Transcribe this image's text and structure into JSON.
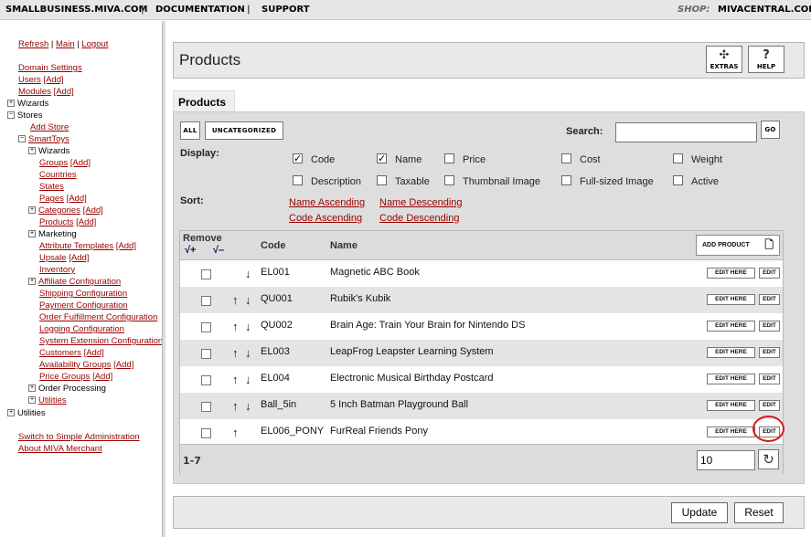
{
  "topbar": {
    "links": [
      "SMALLBUSINESS.MIVA.COM",
      "DOCUMENTATION",
      "SUPPORT"
    ],
    "separator": "|",
    "shop_label": "SHOP:",
    "shop_value": "MIVACENTRAL.COM"
  },
  "leftnav": {
    "refresh": "Refresh",
    "sep": "|",
    "main": "Main",
    "logout": "Logout",
    "domain_settings": "Domain Settings",
    "users": "Users",
    "add": "[Add]",
    "modules": "Modules",
    "wizards": "Wizards",
    "stores": "Stores",
    "add_store": "Add Store",
    "smarttoys": "SmartToys",
    "store_items": [
      {
        "label": "Wizards",
        "tree": true,
        "link": false,
        "add": false
      },
      {
        "label": "Groups",
        "tree": false,
        "link": true,
        "add": true
      },
      {
        "label": "Countries",
        "tree": false,
        "link": true,
        "add": false
      },
      {
        "label": "States",
        "tree": false,
        "link": true,
        "add": false
      },
      {
        "label": "Pages",
        "tree": false,
        "link": true,
        "add": true
      },
      {
        "label": "Categories",
        "tree": true,
        "link": true,
        "add": true
      },
      {
        "label": "Products",
        "tree": false,
        "link": true,
        "add": true
      },
      {
        "label": "Marketing",
        "tree": true,
        "link": false,
        "add": false
      },
      {
        "label": "Attribute Templates",
        "tree": false,
        "link": true,
        "add": true
      },
      {
        "label": "Upsale",
        "tree": false,
        "link": true,
        "add": true
      },
      {
        "label": "Inventory",
        "tree": false,
        "link": true,
        "add": false
      },
      {
        "label": "Affiliate Configuration",
        "tree": true,
        "link": true,
        "add": false
      },
      {
        "label": "Shipping Configuration",
        "tree": false,
        "link": true,
        "add": false
      },
      {
        "label": "Payment Configuration",
        "tree": false,
        "link": true,
        "add": false
      },
      {
        "label": "Order Fulfillment Configuration",
        "tree": false,
        "link": true,
        "add": false
      },
      {
        "label": "Logging Configuration",
        "tree": false,
        "link": true,
        "add": false
      },
      {
        "label": "System Extension Configuration",
        "tree": false,
        "link": true,
        "add": false
      },
      {
        "label": "Customers",
        "tree": false,
        "link": true,
        "add": true
      },
      {
        "label": "Availability Groups",
        "tree": false,
        "link": true,
        "add": true
      },
      {
        "label": "Price Groups",
        "tree": false,
        "link": true,
        "add": true
      },
      {
        "label": "Order Processing",
        "tree": true,
        "link": false,
        "add": false
      },
      {
        "label": "Utilities",
        "tree": true,
        "link": true,
        "add": false
      }
    ],
    "utilities_root": "Utilities",
    "switch_simple": "Switch to Simple Administration",
    "about": "About MIVA Merchant"
  },
  "header": {
    "title": "Products",
    "extras_label": "EXTRAS",
    "help_label": "HELP"
  },
  "tab": {
    "label": "Products"
  },
  "filters": {
    "all": "ALL",
    "uncategorized": "UNCATEGORIZED",
    "search_label": "Search:",
    "search_value": "",
    "go": "GO",
    "display_label": "Display:",
    "sort_label": "Sort:"
  },
  "display_options": [
    {
      "label": "Code",
      "checked": true
    },
    {
      "label": "Name",
      "checked": true
    },
    {
      "label": "Price",
      "checked": false
    },
    {
      "label": "Cost",
      "checked": false
    },
    {
      "label": "Weight",
      "checked": false
    },
    {
      "label": "Description",
      "checked": false
    },
    {
      "label": "Taxable",
      "checked": false
    },
    {
      "label": "Thumbnail Image",
      "checked": false
    },
    {
      "label": "Full-sized Image",
      "checked": false
    },
    {
      "label": "Active",
      "checked": false
    }
  ],
  "sort": {
    "name_asc": "Name Ascending",
    "name_desc": "Name Descending",
    "code_asc": "Code Ascending",
    "code_desc": "Code Descending"
  },
  "table": {
    "remove_header": "Remove",
    "check_plus": "√+",
    "check_minus": "√–",
    "code_header": "Code",
    "name_header": "Name",
    "add_product": "ADD PRODUCT",
    "edit_here": "EDIT HERE",
    "edit": "EDIT",
    "rows": [
      {
        "code": "EL001",
        "name": "Magnetic ABC Book",
        "up": false,
        "down": true
      },
      {
        "code": "QU001",
        "name": "Rubik's Kubik",
        "up": true,
        "down": true
      },
      {
        "code": "QU002",
        "name": "Brain Age: Train Your Brain for Nintendo DS",
        "up": true,
        "down": true
      },
      {
        "code": "EL003",
        "name": "LeapFrog Leapster Learning System",
        "up": true,
        "down": true
      },
      {
        "code": "EL004",
        "name": "Electronic Musical Birthday Postcard",
        "up": true,
        "down": true
      },
      {
        "code": "Ball_5in",
        "name": "5 Inch Batman Playground Ball",
        "up": true,
        "down": true
      },
      {
        "code": "EL006_PONY",
        "name": "FurReal Friends Pony",
        "up": true,
        "down": false
      }
    ],
    "range": "1-7",
    "per_page": "10"
  },
  "buttons": {
    "update": "Update",
    "reset": "Reset"
  },
  "colors": {
    "link": "#990000",
    "arrow": "#00145a",
    "highlight_circle": "#d81818"
  }
}
